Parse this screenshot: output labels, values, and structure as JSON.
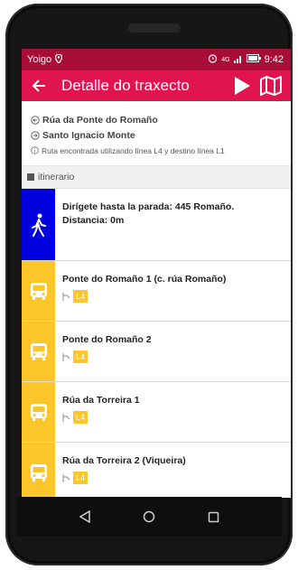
{
  "status": {
    "carrier": "Yoigo",
    "network": "4G",
    "time": "9:42"
  },
  "appbar": {
    "title": "Detalle do traxecto"
  },
  "summary": {
    "origin": "Rúa da Ponte do Romaño",
    "destination": "Santo Ignacio Monte",
    "note": "Ruta encontrada utilizando línea L4 y destino línea L1"
  },
  "section": {
    "title": "itinerario"
  },
  "walk": {
    "line1": "Dirígete hasta la parada: 445 Romaño.",
    "line2": "Distancia: 0m"
  },
  "stops": [
    {
      "name": "Ponte do Romaño 1 (c. rúa Romaño)",
      "line": "L4"
    },
    {
      "name": "Ponte do Romaño 2",
      "line": "L4"
    },
    {
      "name": "Rúa da Torreira 1",
      "line": "L4"
    },
    {
      "name": "Rúa da Torreira 2 (Viqueira)",
      "line": "L4"
    }
  ],
  "icons": {
    "back": "arrow-back-icon",
    "play": "play-icon",
    "map": "map-icon",
    "walk": "pedestrian-icon",
    "bus": "bus-icon",
    "route_branch": "route-branch-icon"
  },
  "colors": {
    "appbar": "#e0154f",
    "statusbar": "#a80d38",
    "walk": "#0000dd",
    "bus": "#fcc62a"
  }
}
